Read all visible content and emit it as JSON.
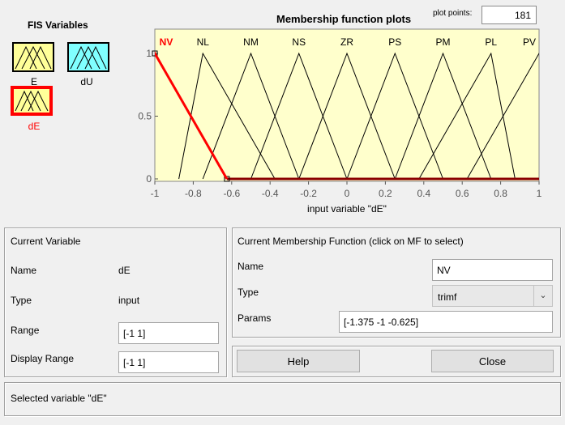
{
  "fis": {
    "title": "FIS Variables",
    "inputs": [
      {
        "name": "E",
        "color": "#ffff99"
      },
      {
        "name": "dE",
        "color": "#ffff99",
        "selected": true
      }
    ],
    "outputs": [
      {
        "name": "dU",
        "color": "#80ffff"
      }
    ],
    "selected_color": "#ff0000"
  },
  "plot": {
    "title": "Membership function plots",
    "plot_points_label": "plot points:",
    "plot_points_value": "181",
    "xlabel": "input variable \"dE\"",
    "background": "#ffffcc",
    "selected_mf_color": "#ff0000"
  },
  "chart_data": {
    "type": "line",
    "xlim": [
      -1,
      1
    ],
    "ylim": [
      0,
      1
    ],
    "xticks": [
      "-1",
      "-0.8",
      "-0.6",
      "-0.4",
      "-0.2",
      "0",
      "0.2",
      "0.4",
      "0.6",
      "0.8",
      "1"
    ],
    "yticks": [
      "0",
      "0.5",
      "1"
    ],
    "xlabel": "input variable \"dE\"",
    "selected": "NV",
    "series": [
      {
        "name": "NV",
        "params": [
          -1.375,
          -1,
          -0.625
        ]
      },
      {
        "name": "NL",
        "params": [
          -0.875,
          -0.75,
          -0.375
        ]
      },
      {
        "name": "NM",
        "params": [
          -0.75,
          -0.5,
          -0.25
        ]
      },
      {
        "name": "NS",
        "params": [
          -0.5,
          -0.25,
          0
        ]
      },
      {
        "name": "ZR",
        "params": [
          -0.25,
          0,
          0.25
        ]
      },
      {
        "name": "PS",
        "params": [
          0,
          0.25,
          0.5
        ]
      },
      {
        "name": "PM",
        "params": [
          0.25,
          0.5,
          0.75
        ]
      },
      {
        "name": "PL",
        "params": [
          0.375,
          0.75,
          0.875
        ]
      },
      {
        "name": "PV",
        "params": [
          0.625,
          1,
          1.375
        ]
      }
    ]
  },
  "current_variable": {
    "title": "Current Variable",
    "name_label": "Name",
    "name_value": "dE",
    "type_label": "Type",
    "type_value": "input",
    "range_label": "Range",
    "range_value": "[-1 1]",
    "display_range_label": "Display Range",
    "display_range_value": "[-1 1]"
  },
  "current_mf": {
    "title": "Current Membership Function (click on MF to select)",
    "name_label": "Name",
    "name_value": "NV",
    "type_label": "Type",
    "type_value": "trimf",
    "params_label": "Params",
    "params_value": "[-1.375 -1 -0.625]"
  },
  "buttons": {
    "help": "Help",
    "close": "Close"
  },
  "status": "Selected variable \"dE\""
}
